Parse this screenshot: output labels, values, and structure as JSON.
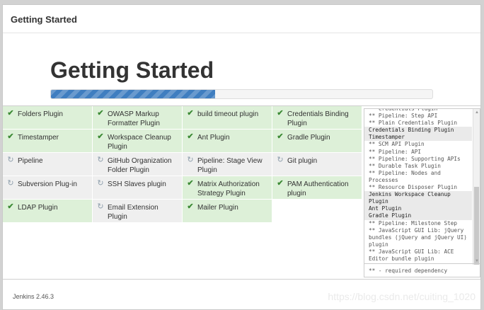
{
  "header": {
    "title": "Getting Started"
  },
  "hero": {
    "title": "Getting Started",
    "progress": 0.43
  },
  "plugins": [
    {
      "label": "Folders Plugin",
      "status": "success"
    },
    {
      "label": "OWASP Markup Formatter Plugin",
      "status": "success"
    },
    {
      "label": "build timeout plugin",
      "status": "success"
    },
    {
      "label": "Credentials Binding Plugin",
      "status": "success"
    },
    {
      "label": "Timestamper",
      "status": "success"
    },
    {
      "label": "Workspace Cleanup Plugin",
      "status": "success"
    },
    {
      "label": "Ant Plugin",
      "status": "success"
    },
    {
      "label": "Gradle Plugin",
      "status": "success"
    },
    {
      "label": "Pipeline",
      "status": "pending"
    },
    {
      "label": "GitHub Organization Folder Plugin",
      "status": "pending"
    },
    {
      "label": "Pipeline: Stage View Plugin",
      "status": "pending"
    },
    {
      "label": "Git plugin",
      "status": "pending"
    },
    {
      "label": "Subversion Plug-in",
      "status": "pending"
    },
    {
      "label": "SSH Slaves plugin",
      "status": "pending"
    },
    {
      "label": "Matrix Authorization Strategy Plugin",
      "status": "success"
    },
    {
      "label": "PAM Authentication plugin",
      "status": "success"
    },
    {
      "label": "LDAP Plugin",
      "status": "success"
    },
    {
      "label": "Email Extension Plugin",
      "status": "pending"
    },
    {
      "label": "Mailer Plugin",
      "status": "success"
    }
  ],
  "log": {
    "lines": [
      {
        "text": "** Credentials Plugin",
        "head": false
      },
      {
        "text": "** Pipeline: Step API",
        "head": false
      },
      {
        "text": "** Plain Credentials Plugin",
        "head": false
      },
      {
        "text": "Credentials Binding Plugin",
        "head": true
      },
      {
        "text": "Timestamper",
        "head": true
      },
      {
        "text": "** SCM API Plugin",
        "head": false
      },
      {
        "text": "** Pipeline: API",
        "head": false
      },
      {
        "text": "** Pipeline: Supporting APIs",
        "head": false
      },
      {
        "text": "** Durable Task Plugin",
        "head": false
      },
      {
        "text": "** Pipeline: Nodes and Processes",
        "head": false
      },
      {
        "text": "** Resource Disposer Plugin",
        "head": false
      },
      {
        "text": "Jenkins Workspace Cleanup Plugin",
        "head": true
      },
      {
        "text": "Ant Plugin",
        "head": true
      },
      {
        "text": "Gradle Plugin",
        "head": true
      },
      {
        "text": "** Pipeline: Milestone Step",
        "head": false
      },
      {
        "text": "** JavaScript GUI Lib: jQuery bundles (jQuery and jQuery UI) plugin",
        "head": false
      },
      {
        "text": "** JavaScript GUI Lib: ACE Editor bundle plugin",
        "head": false
      }
    ],
    "footer": "** - required dependency"
  },
  "footer": {
    "version": "Jenkins 2.46.3",
    "watermark": "https://blog.csdn.net/cuiting_1020"
  },
  "colors": {
    "success_bg": "#ddf0d8",
    "pending_bg": "#efefef",
    "check": "#3c8a35",
    "pending_icon": "#8fa0ad",
    "progress": "#3f7ec0"
  },
  "icons": {
    "success": "check-icon",
    "pending": "refresh-icon"
  }
}
